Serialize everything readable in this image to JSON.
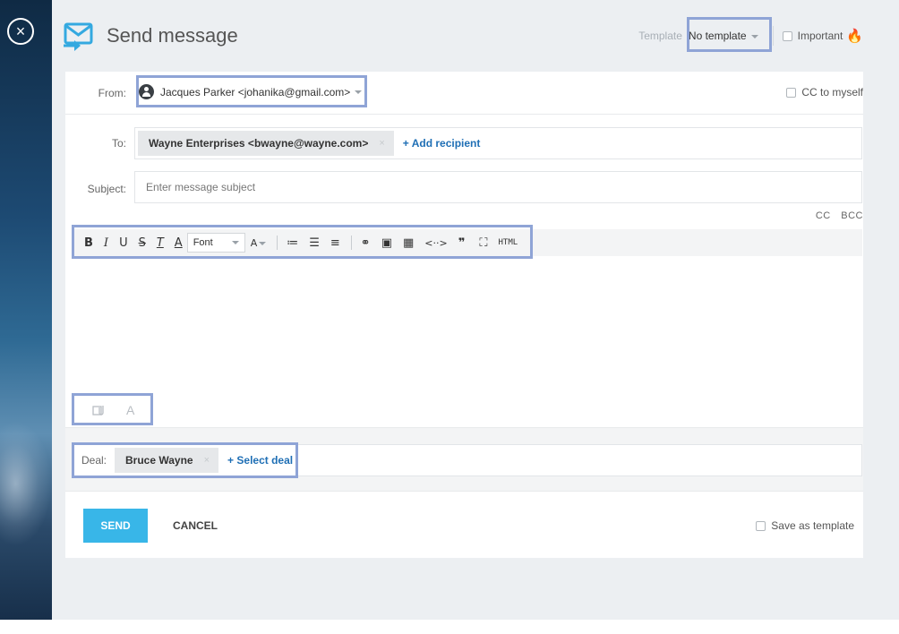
{
  "window": {
    "close_glyph": "×"
  },
  "header": {
    "title": "Send message",
    "template_label": "Template",
    "template_value": "No template",
    "important_label": "Important",
    "icons": {
      "app": "envelope-send-icon",
      "important": "flame-icon"
    }
  },
  "from": {
    "label": "From:",
    "value": "Jacques Parker <johanika@gmail.com>",
    "cc_myself_label": "CC to myself"
  },
  "to": {
    "label": "To:",
    "recipient": "Wayne Enterprises <bwayne@wayne.com>",
    "remove_glyph": "×",
    "add_label": "+ Add recipient"
  },
  "subject": {
    "label": "Subject:",
    "placeholder": "Enter message subject",
    "value": ""
  },
  "cc_bcc": {
    "cc": "CC",
    "bcc": "BCC"
  },
  "toolbar": {
    "bold": "B",
    "italic": "I",
    "underline": "U",
    "strike": "S",
    "clear_format": "T",
    "text_color": "A",
    "font": "Font",
    "font_size": "A",
    "ordered_list": "≔",
    "bullet_list": "☰",
    "align": "≡",
    "link": "⚭",
    "image": "▣",
    "table": "▦",
    "code": "<··>",
    "quote": "❞",
    "fullscreen": "⛶",
    "html": "HTML"
  },
  "editor_tools": {
    "text_format": "A"
  },
  "deal": {
    "label": "Deal:",
    "value": "Bruce Wayne",
    "remove_glyph": "×",
    "select_label": "+ Select deal"
  },
  "footer": {
    "send": "SEND",
    "cancel": "CANCEL",
    "save_template": "Save as template"
  },
  "colors": {
    "accent": "#38b6e8",
    "link": "#1f6fb5",
    "highlight_border": "#8fa4d6",
    "flame": "#f0701e"
  }
}
